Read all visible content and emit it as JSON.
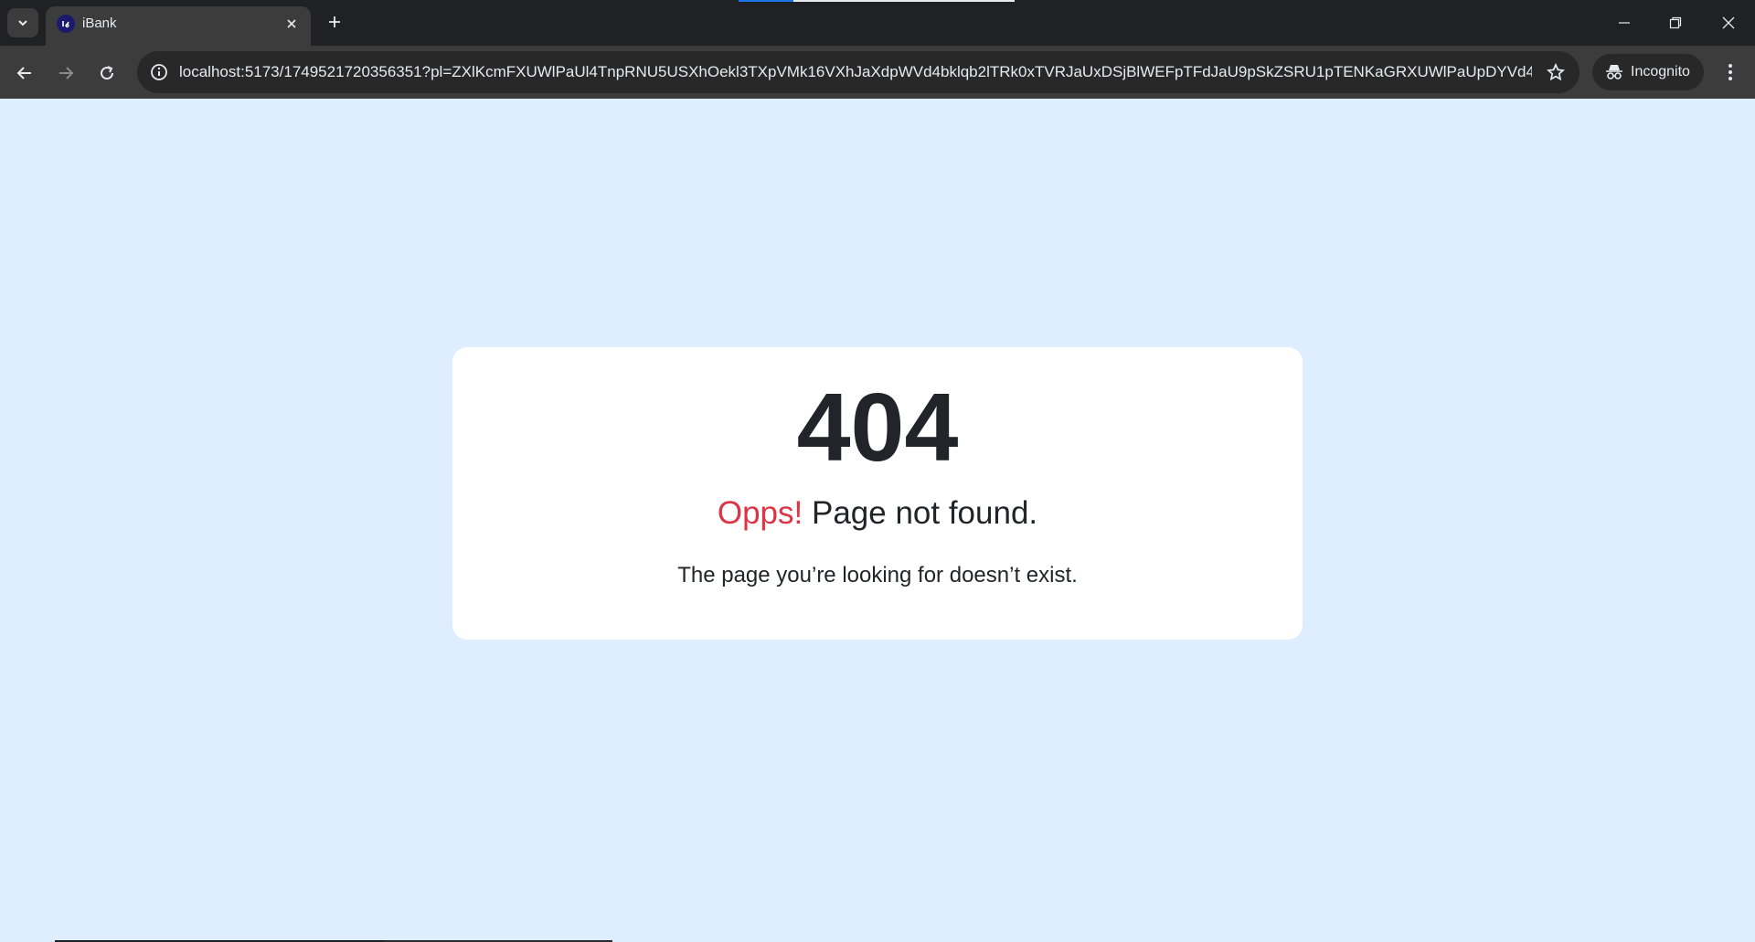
{
  "browser": {
    "tab": {
      "title": "iBank"
    },
    "address_bar": {
      "url": "localhost:5173/1749521720356351?pl=ZXlKcmFXUWlPaUl4TnpRNU5USXhOekl3TXpVMk16VXhJaXdpWVd4bklqb2lTRk0xTVRJaUxDSjBlWEFpTFdJaU9pSkZSRU1pTENKaGRXUWlPaUpDYVd4c1V..."
    },
    "incognito_label": "Incognito"
  },
  "page": {
    "error_code": "404",
    "headline_highlight": "Opps!",
    "headline_rest": " Page not found.",
    "message": "The page you’re looking for doesn’t exist."
  },
  "colors": {
    "page_background": "#deeefe",
    "highlight": "#dc3545",
    "text": "#212529",
    "chrome_dark": "#202124",
    "chrome_toolbar": "#3c3c3c"
  }
}
